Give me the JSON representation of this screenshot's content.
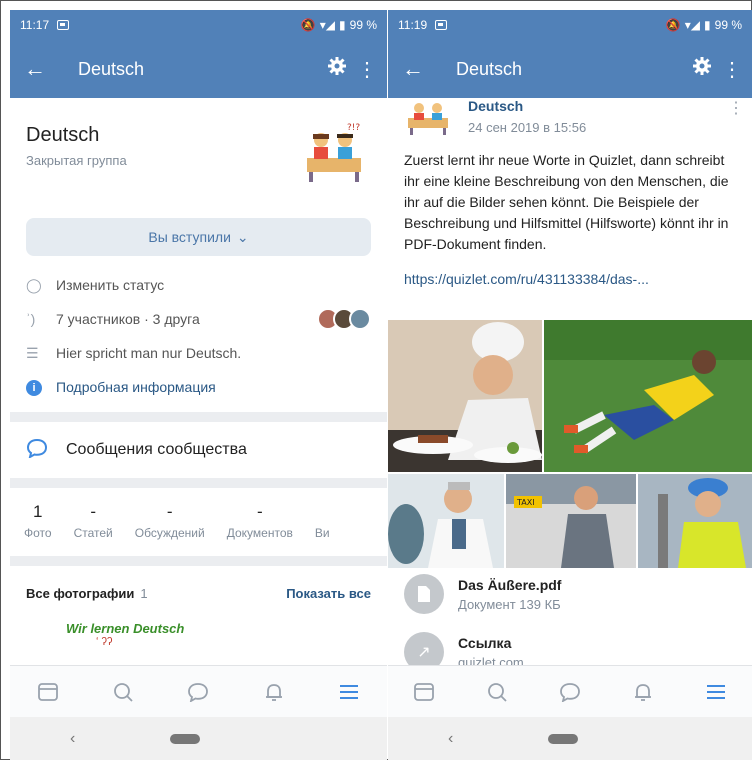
{
  "colors": {
    "header": "#5181b8",
    "link": "#2a5885",
    "accent": "#3f8ae0",
    "tabbar_active": "#3f8ae0"
  },
  "left": {
    "status": {
      "time": "11:17",
      "battery": "99 %"
    },
    "appbar": {
      "title": "Deutsch",
      "back_icon": "arrow-left-icon",
      "settings_icon": "gear-icon",
      "more_icon": "more-vertical-icon"
    },
    "group": {
      "name": "Deutsch",
      "type": "Закрытая группа"
    },
    "join_button": "Вы вступили",
    "info": {
      "status": "Изменить статус",
      "members": "7 участников · 3 друга",
      "description": "Hier spricht man nur Deutsch.",
      "more": "Подробная информация"
    },
    "messages": "Сообщения сообщества",
    "counters": [
      {
        "num": "1",
        "label": "Фото"
      },
      {
        "num": "-",
        "label": "Статей"
      },
      {
        "num": "-",
        "label": "Обсуждений"
      },
      {
        "num": "-",
        "label": "Документов"
      },
      {
        "num": "",
        "label": "Ви"
      }
    ],
    "photos": {
      "title": "Все фотографии",
      "count": "1",
      "show_all": "Показать все",
      "thumb_text": "Wir lernen Deutsch"
    }
  },
  "right": {
    "status": {
      "time": "11:19",
      "battery": "99 %"
    },
    "appbar": {
      "title": "Deutsch"
    },
    "post": {
      "author": "Deutsch",
      "date": "24 сен 2019 в 15:56",
      "text": "Zuerst lernt ihr neue Worte in Quizlet, dann schreibt ihr eine kleine Beschreibung von den Menschen, die ihr auf die Bilder sehen könnt. Die Beispiele der Beschreibung und Hilfsmittel (Hilfsworte) könnt ihr in PDF-Dokument finden.",
      "link": "https://quizlet.com/ru/431133384/das-..."
    },
    "attachments": [
      {
        "title": "Das Äußere.pdf",
        "subtitle": "Документ 139 КБ",
        "icon": "document-icon"
      },
      {
        "title": "Ссылка",
        "subtitle": "quizlet.com",
        "icon": "link-arrow-icon"
      }
    ]
  },
  "tabbar": [
    "news-icon",
    "search-icon",
    "messages-icon",
    "notifications-icon",
    "menu-icon"
  ]
}
